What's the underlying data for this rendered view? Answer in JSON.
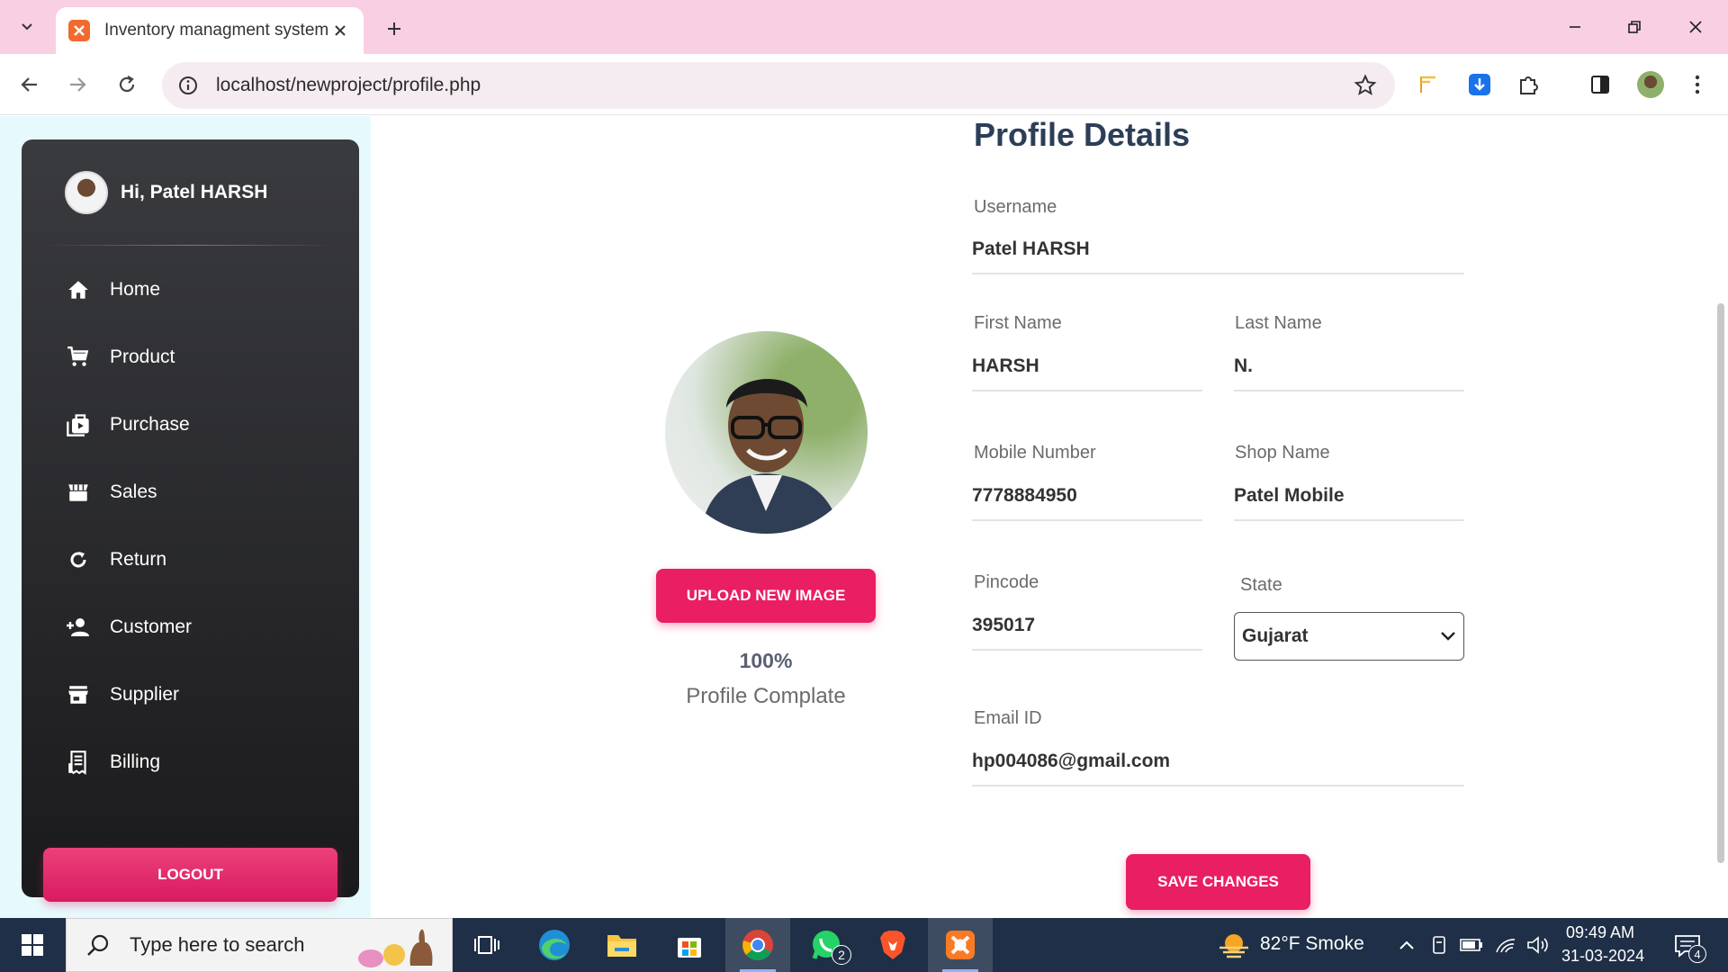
{
  "browser": {
    "tab_title": "Inventory managment system",
    "url": "localhost/newproject/profile.php"
  },
  "sidebar": {
    "greeting": "Hi, Patel HARSH",
    "items": [
      {
        "label": "Home",
        "icon": "home-icon"
      },
      {
        "label": "Product",
        "icon": "cart-icon"
      },
      {
        "label": "Purchase",
        "icon": "purchase-icon"
      },
      {
        "label": "Sales",
        "icon": "store-icon"
      },
      {
        "label": "Return",
        "icon": "refresh-icon"
      },
      {
        "label": "Customer",
        "icon": "add-person-icon"
      },
      {
        "label": "Supplier",
        "icon": "shop-icon"
      },
      {
        "label": "Billing",
        "icon": "receipt-icon"
      }
    ],
    "logout_label": "LOGOUT"
  },
  "profile": {
    "title": "Profile Details",
    "upload_label": "UPLOAD NEW IMAGE",
    "completion_percent": "100%",
    "completion_label": "Profile Complate",
    "fields": {
      "username": {
        "label": "Username",
        "value": "Patel HARSH"
      },
      "first_name": {
        "label": "First Name",
        "value": "HARSH"
      },
      "last_name": {
        "label": "Last Name",
        "value": "N."
      },
      "mobile": {
        "label": "Mobile Number",
        "value": "7778884950"
      },
      "shop_name": {
        "label": "Shop Name",
        "value": "Patel Mobile"
      },
      "pincode": {
        "label": "Pincode",
        "value": "395017"
      },
      "state": {
        "label": "State",
        "value": "Gujarat"
      },
      "email": {
        "label": "Email ID",
        "value": "hp004086@gmail.com"
      }
    },
    "save_label": "SAVE CHANGES"
  },
  "taskbar": {
    "search_placeholder": "Type here to search",
    "weather": "82°F  Smoke",
    "time": "09:49 AM",
    "date": "31-03-2024",
    "whatsapp_badge": "2",
    "notification_count": "4"
  },
  "colors": {
    "accent": "#e91e63",
    "sidebar_top": "#3a3b3f",
    "sidebar_bottom": "#1a1a1c",
    "titlebar": "#f8cfe3",
    "taskbar": "#1f2f47",
    "heading": "#2c3e58"
  }
}
